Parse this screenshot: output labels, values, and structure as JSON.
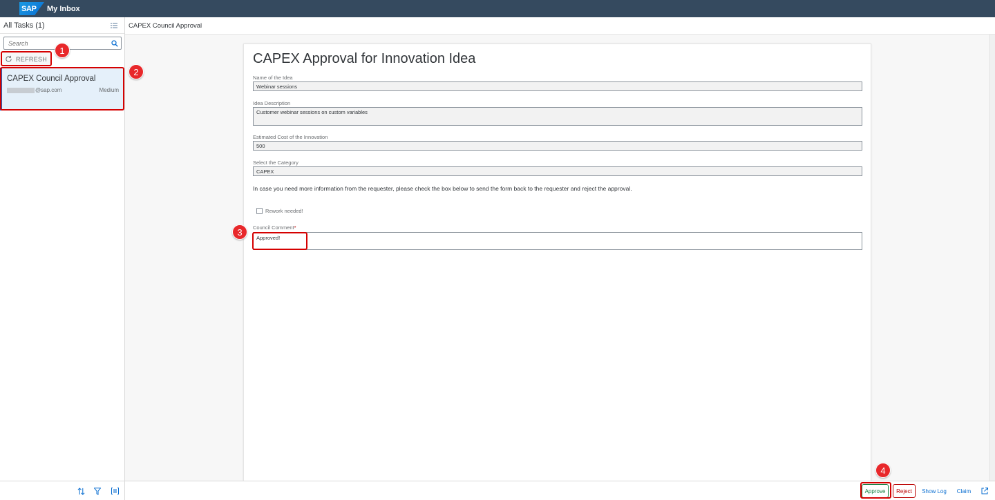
{
  "shell": {
    "logo_text": "SAP",
    "app_title": "My Inbox"
  },
  "master": {
    "header": "All Tasks (1)",
    "search_placeholder": "Search",
    "refresh_label": "REFRESH",
    "task": {
      "title": "CAPEX Council Approval",
      "email": "@sap.com",
      "priority": "Medium"
    }
  },
  "detail": {
    "header": "CAPEX Council Approval",
    "form": {
      "title": "CAPEX Approval for Innovation Idea",
      "idea_name_label": "Name of the Idea",
      "idea_name_value": "Webinar sessions",
      "idea_desc_label": "Idea Description",
      "idea_desc_value": "Customer webinar sessions on custom variables",
      "cost_label": "Estimated Cost of the Innovation",
      "cost_value": "500",
      "category_label": "Select the Category",
      "category_value": "CAPEX",
      "note": "In case you need more information from the requester, please check the box below to send the form back to the requester and reject the approval.",
      "rework_label": "Rework needed!",
      "comment_label": "Council Comment",
      "comment_required": "*",
      "comment_value": "Approved!"
    }
  },
  "footer": {
    "approve": "Approve",
    "reject": "Reject",
    "show_log": "Show Log",
    "claim": "Claim"
  },
  "callouts": [
    "1",
    "2",
    "3",
    "4"
  ],
  "colors": {
    "shell": "#354a5f",
    "accent": "#0a6ed1",
    "approve": "#107e3e",
    "reject": "#bb0000",
    "callout": "#e8282b"
  }
}
